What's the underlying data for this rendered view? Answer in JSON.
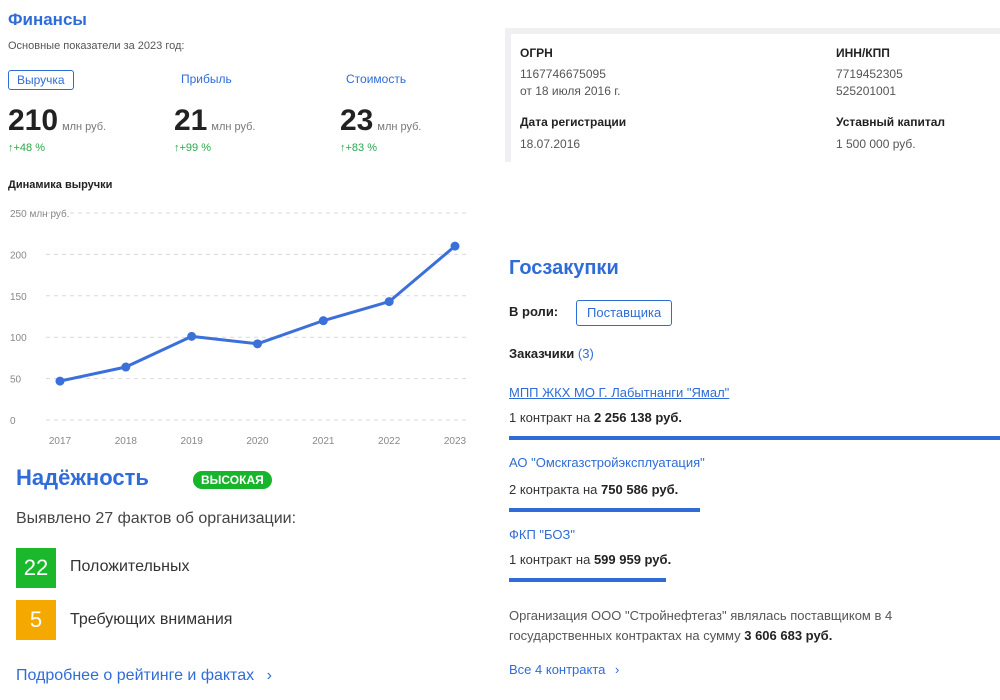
{
  "finance": {
    "title": "Финансы",
    "subtitle": "Основные показатели за 2023 год:",
    "tabs": [
      "Выручка",
      "Прибыль",
      "Стоимость"
    ],
    "metrics": [
      {
        "value": "210",
        "unit": "млн руб.",
        "delta": "↑+48 %"
      },
      {
        "value": "21",
        "unit": "млн руб.",
        "delta": "↑+99 %"
      },
      {
        "value": "23",
        "unit": "млн руб.",
        "delta": "↑+83 %"
      }
    ]
  },
  "requisites": {
    "ogrn_label": "ОГРН",
    "ogrn_value": "1167746675095",
    "ogrn_date": "от 18 июля 2016 г.",
    "inn_label": "ИНН/КПП",
    "inn_value": "7719452305",
    "kpp_value": "525201001",
    "reg_label": "Дата регистрации",
    "reg_value": "18.07.2016",
    "capital_label": "Уставный капитал",
    "capital_value": "1 500 000 руб."
  },
  "chart_data": {
    "type": "line",
    "title": "Динамика выручки",
    "xlabel": "",
    "ylabel": "",
    "ytop_label": "250 млн руб.",
    "categories": [
      "2017",
      "2018",
      "2019",
      "2020",
      "2021",
      "2022",
      "2023"
    ],
    "values": [
      47,
      64,
      101,
      92,
      120,
      143,
      210
    ],
    "yticks": [
      0,
      50,
      100,
      150,
      200,
      250
    ],
    "ylim": [
      0,
      250
    ],
    "grid": true,
    "color": "#3b6fd9"
  },
  "reliability": {
    "title": "Надёжность",
    "badge": "высокая",
    "facts": "Выявлено 27 фактов об организации:",
    "positive_count": "22",
    "positive_label": "Положительных",
    "attention_count": "5",
    "attention_label": "Требующих внимания",
    "more": "Подробнее о рейтинге и фактах",
    "colors": {
      "positive": "#1cb82c",
      "attention": "#f5a900"
    }
  },
  "procurement": {
    "title": "Госзакупки",
    "role_label": "В роли:",
    "role_value": "Поставщика",
    "customers_label": "Заказчики",
    "customers_count": "(3)",
    "customers": [
      {
        "name": "МПП ЖКХ МО Г. Лабытнанги \"Ямал\"",
        "contracts": "1 контракт на",
        "amount": "2 256 138 руб.",
        "share": 1.0
      },
      {
        "name": "АО \"Омскгазстройэксплуатация\"",
        "contracts": "2 контракта на",
        "amount": "750 586 руб.",
        "share": 0.39
      },
      {
        "name": "ФКП \"БОЗ\"",
        "contracts": "1 контракт на",
        "amount": "599 959 руб.",
        "share": 0.32
      }
    ],
    "summary_text": "Организация ООО \"Стройнефтегаз\" являлась поставщиком в 4 государственных контрактах на сумму",
    "summary_amount": "3 606 683 руб.",
    "all_link": "Все 4 контракта"
  }
}
